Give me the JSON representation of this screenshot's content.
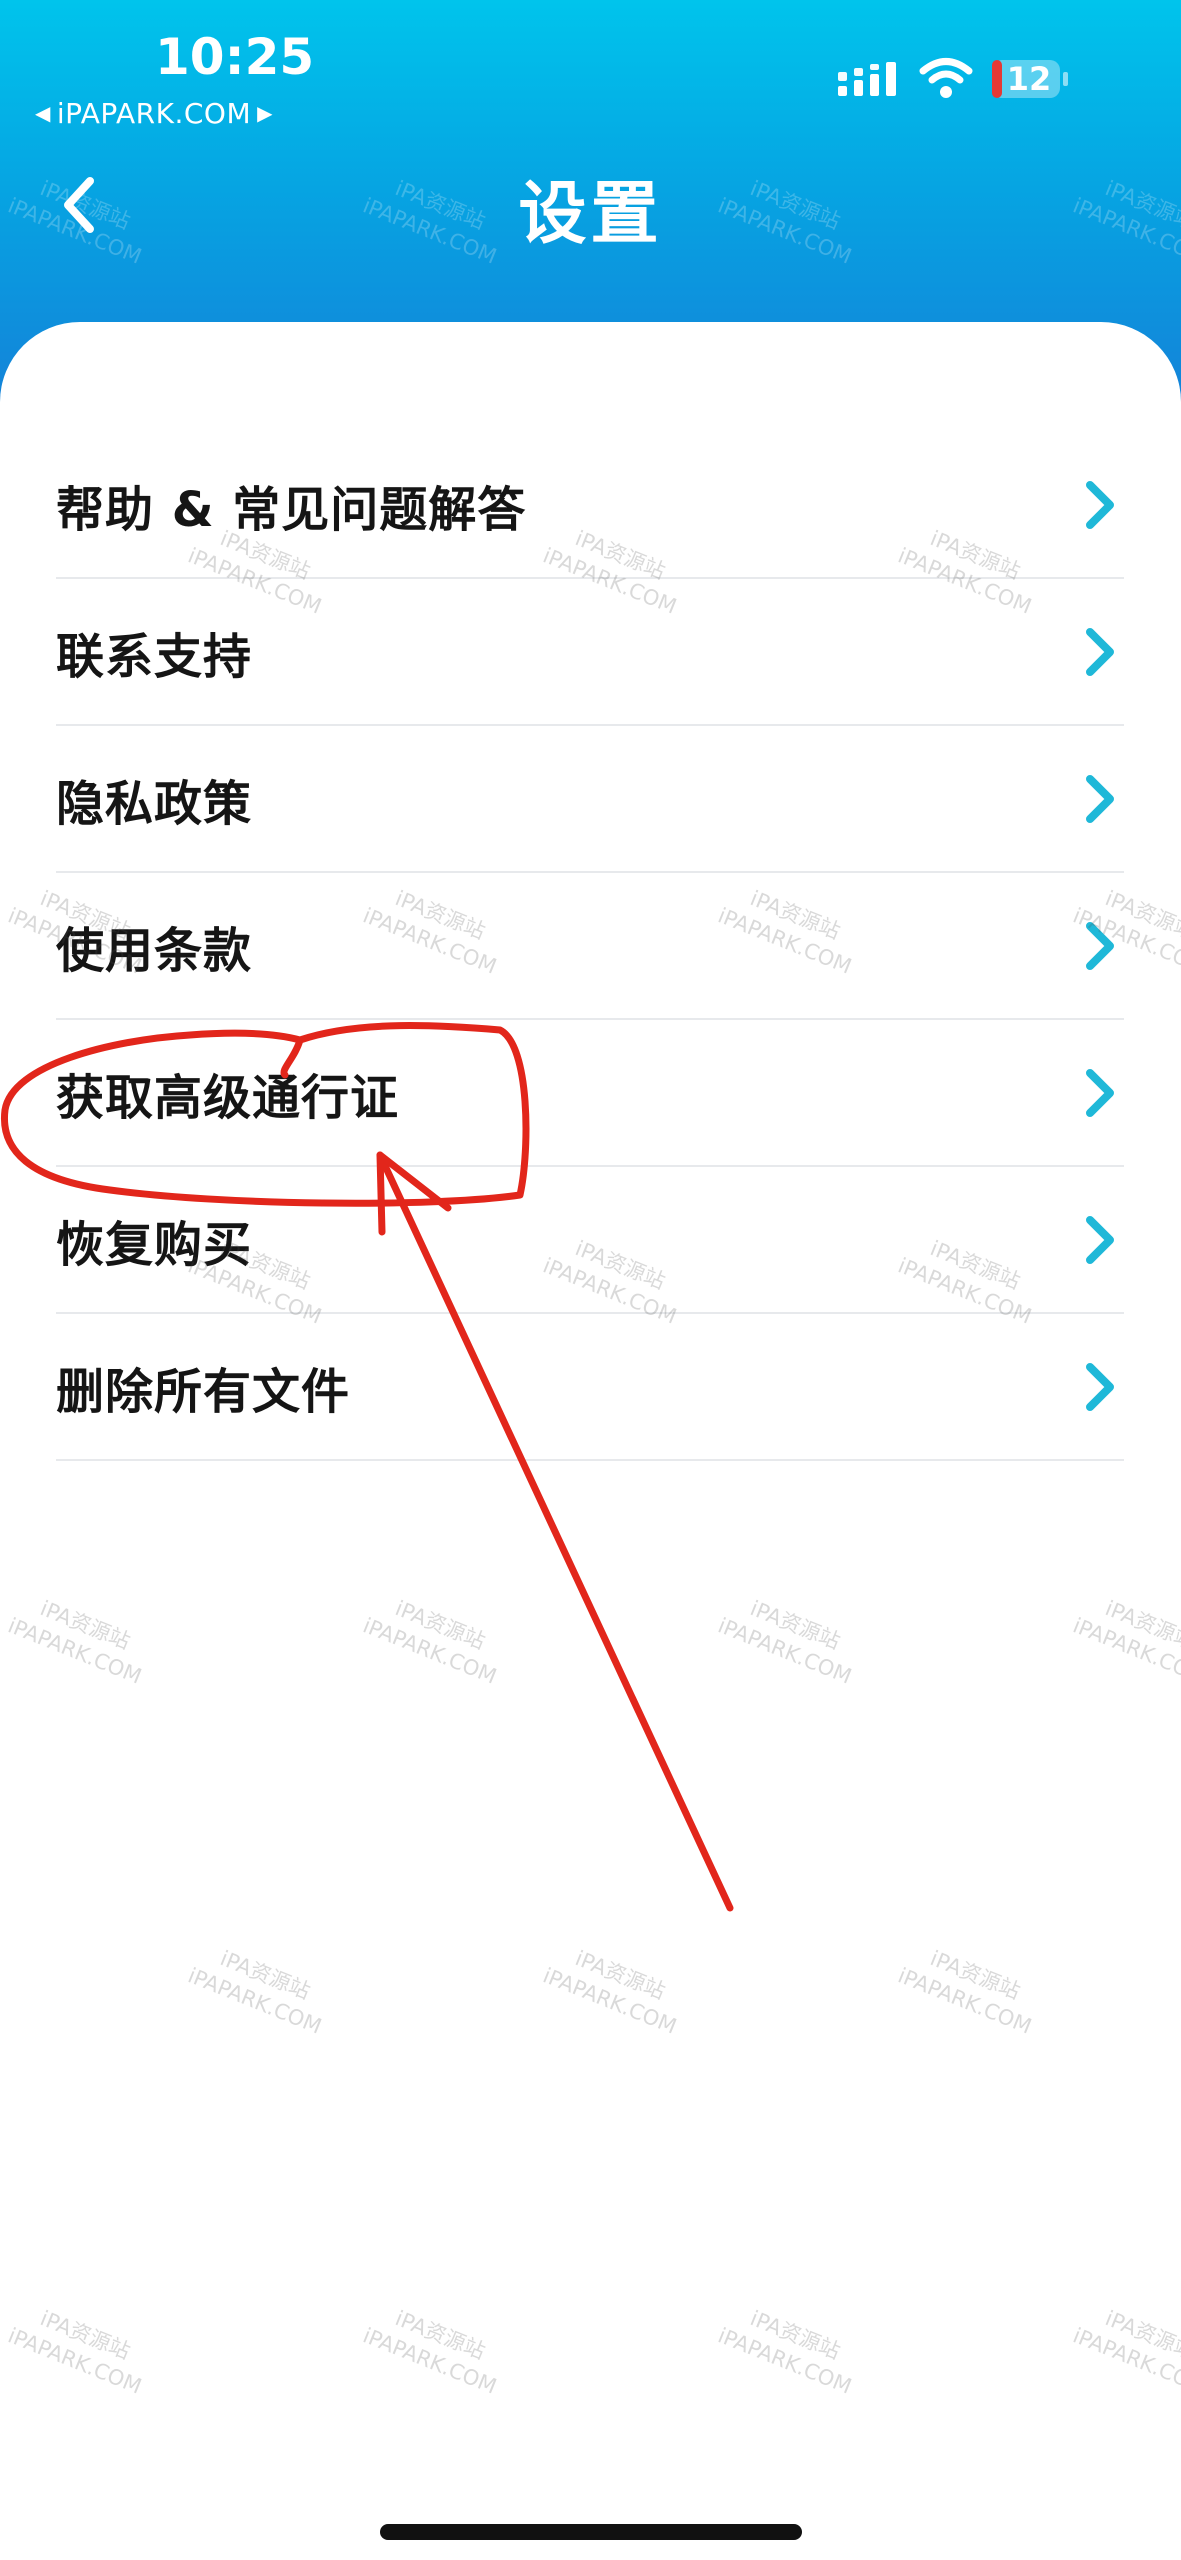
{
  "status_bar": {
    "time": "10:25",
    "back_app": "iPAPARK.COM",
    "battery": "12",
    "back_app_arrow_left_icon": "triangle-left-icon",
    "back_app_arrow_right_icon": "triangle-right-icon"
  },
  "header": {
    "title": "设置",
    "back_icon": "chevron-left-icon"
  },
  "menu": {
    "items": [
      {
        "label": "帮助 & 常见问题解答"
      },
      {
        "label": "联系支持"
      },
      {
        "label": "隐私政策"
      },
      {
        "label": "使用条款"
      },
      {
        "label": "获取高级通行证"
      },
      {
        "label": "恢复购买"
      },
      {
        "label": "删除所有文件"
      }
    ],
    "chevron_icon": "chevron-right-icon"
  },
  "watermark": {
    "line1": "iPA资源站",
    "line2": "iPAPARK.COM"
  },
  "colors": {
    "header_top": "#00c4ec",
    "header_bottom": "#1580d8",
    "chevron": "#1fb8d8",
    "annotation": "#e2261b",
    "divider": "#e7e9ec",
    "battery_low": "#e53935"
  },
  "annotation": {
    "shape": "hand-drawn circle around menu item 获取高级通行证 with arrow pointing to it",
    "color": "#e2261b"
  }
}
